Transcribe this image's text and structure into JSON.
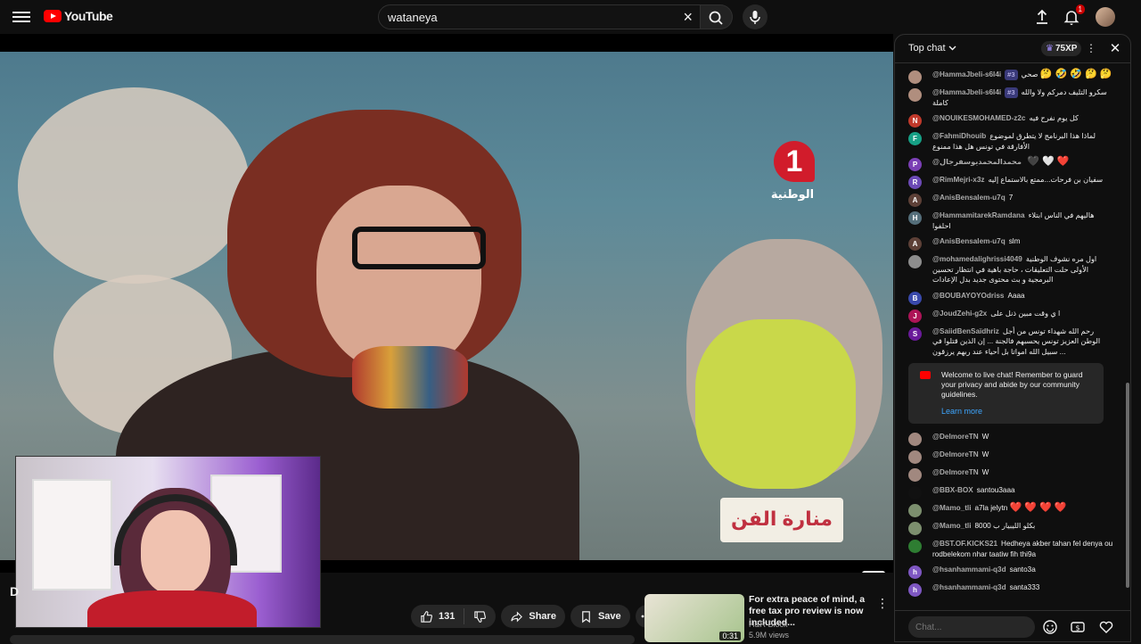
{
  "header": {
    "logo_text": "YouTube",
    "search_value": "wataneya",
    "notifications_count": "1"
  },
  "video": {
    "channel_logo_num": "1",
    "channel_logo_text": "الوطنية",
    "show_logo_text": "منارة الفن",
    "title_stub": "D"
  },
  "actions": {
    "like_count": "131",
    "share_label": "Share",
    "save_label": "Save"
  },
  "ad": {
    "title": "For extra peace of mind, a free tax pro review is now included...",
    "advertiser": "H&R Block",
    "views": "5.9M views",
    "duration": "0:31"
  },
  "chat": {
    "mode_label": "Top chat",
    "xp_label": "75XP",
    "input_placeholder": "Chat...",
    "messages": [
      {
        "author": "@HammaJbeli-s6l4i",
        "badge": "#3",
        "text": "صحي",
        "emoji": "🤔 🤣 🤣 🤔 🤔",
        "avatar_letter": "",
        "avatar_color": "#b08e7e"
      },
      {
        "author": "@HammaJbeli-s6l4i",
        "badge": "#3",
        "text": "سكرو التليف دمركم ولا والله كاملة",
        "emoji": "",
        "avatar_letter": "",
        "avatar_color": "#b08e7e"
      },
      {
        "author": "@NOUIKESMOHAMED-z2c",
        "badge": "",
        "text": "كل يوم نفرح فيه",
        "emoji": "",
        "avatar_letter": "N",
        "avatar_color": "#c0392b"
      },
      {
        "author": "@FahmiDhouib",
        "badge": "",
        "text": "لماذا هذا البرنامج لا يتطرق لموضوع الأفارقة في تونس هل هذا ممنوع",
        "emoji": "",
        "avatar_letter": "F",
        "avatar_color": "#16a085"
      },
      {
        "author": "@محمدالمحمديوسفرجال",
        "badge": "",
        "text": "",
        "emoji": "",
        "hearts": "🖤 🤍 ❤️",
        "avatar_letter": "P",
        "avatar_color": "#7b3fb5"
      },
      {
        "author": "@RimMejri-x3z",
        "badge": "",
        "text": "سفيان بن فرحات...ممتع بالاستماع إليه",
        "emoji": "",
        "avatar_letter": "R",
        "avatar_color": "#6c4ab6"
      },
      {
        "author": "@AnisBensalem-u7q",
        "badge": "",
        "text": "7",
        "emoji": "",
        "avatar_letter": "A",
        "avatar_color": "#5d4037"
      },
      {
        "author": "@HammamitarekRamdana",
        "badge": "",
        "text": "هاليهم في الناس ابتلاء احلفوا",
        "emoji": "",
        "avatar_letter": "H",
        "avatar_color": "#546e7a"
      },
      {
        "author": "@AnisBensalem-u7q",
        "badge": "",
        "text": "slm",
        "emoji": "",
        "avatar_letter": "A",
        "avatar_color": "#5d4037"
      },
      {
        "author": "@mohamedalighrissi4049",
        "badge": "",
        "text": "اول مره نشوف الوطنية الأولى حلت التعليقات ، حاجة باهية في انتظار تحسين البرمجية و بث محتوى جديد بدل الإعادات",
        "emoji": "",
        "avatar_letter": "",
        "avatar_color": "#8d8d8d"
      },
      {
        "author": "@BOUBAYOYOdriss",
        "badge": "",
        "text": "Aaaa",
        "emoji": "",
        "avatar_letter": "B",
        "avatar_color": "#3949ab"
      },
      {
        "author": "@JoudZehi-g2x",
        "badge": "",
        "text": "ا ي وقت مبين ذنل على",
        "emoji": "",
        "avatar_letter": "J",
        "avatar_color": "#ad1457"
      },
      {
        "author": "@SaiidBenSaïdhriz",
        "badge": "",
        "text": "رحم الله شهداء تونس من أجل الوطن العزيز تونس يحسبهم فالجنة ... إن الذين قتلوا في سبيل الله امواتا بل أحياء عند ربهم يرزقون ...",
        "emoji": "",
        "avatar_letter": "S",
        "avatar_color": "#6a1b9a"
      }
    ],
    "welcome": {
      "text": "Welcome to live chat! Remember to guard your privacy and abide by our community guidelines.",
      "link": "Learn more"
    },
    "messages2": [
      {
        "author": "@DelmoreTN",
        "text": "W",
        "avatar_letter": "",
        "avatar_color": "#a1887f"
      },
      {
        "author": "@DelmoreTN",
        "text": "W",
        "avatar_letter": "",
        "avatar_color": "#a1887f"
      },
      {
        "author": "@DelmoreTN",
        "text": "W",
        "avatar_letter": "",
        "avatar_color": "#a1887f"
      },
      {
        "author": "@BBX-BOX",
        "text": "santou3aaa",
        "avatar_letter": "",
        "avatar_color": "#111111"
      },
      {
        "author": "@Mamo_tli",
        "text": "a7la jelytn",
        "hearts": "❤️ ❤️ ❤️ ❤️",
        "avatar_letter": "",
        "avatar_color": "#7c8f6e"
      },
      {
        "author": "@Mamo_tli",
        "text": "8000 بكلو الليبيار ب",
        "avatar_letter": "",
        "avatar_color": "#7c8f6e"
      },
      {
        "author": "@BST.OF.KICKS21",
        "text": "Hedheya akber tahan fel denya ou rodbelekom nhar taatiw fih thi9a",
        "avatar_letter": "",
        "avatar_color": "#2e7d32"
      },
      {
        "author": "@hsanhammami-q3d",
        "text": "santo3a",
        "avatar_letter": "h",
        "avatar_color": "#7e57c2"
      },
      {
        "author": "@hsanhammami-q3d",
        "text": "santa333",
        "avatar_letter": "h",
        "avatar_color": "#7e57c2"
      }
    ]
  },
  "colors": {
    "accent": "#ff0000",
    "link": "#3ea6ff",
    "background": "#0f0f0f"
  },
  "icons": [
    "menu-icon",
    "youtube-logo-icon",
    "clear-icon",
    "search-icon",
    "mic-icon",
    "create-icon",
    "bell-icon",
    "like-icon",
    "dislike-icon",
    "share-icon",
    "save-icon",
    "more-icon",
    "chevron-down-icon",
    "close-icon",
    "emoji-icon",
    "super-chat-icon",
    "heart-icon"
  ]
}
